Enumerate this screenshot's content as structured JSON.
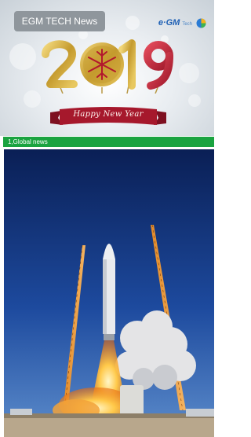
{
  "header": {
    "news_label": "EGM TECH News",
    "logo_text": "e·GM",
    "logo_subtext": "Tech",
    "year": "2019",
    "greeting": "Happy New Year"
  },
  "section": {
    "title": "1,Global news"
  },
  "photo": {
    "subject": "rocket launch"
  },
  "colors": {
    "section_green": "#1aa340",
    "logo_blue": "#1d5fb4",
    "ribbon_red": "#a6182c",
    "gold": "#c9a53a",
    "red_glitter": "#c0283a"
  }
}
